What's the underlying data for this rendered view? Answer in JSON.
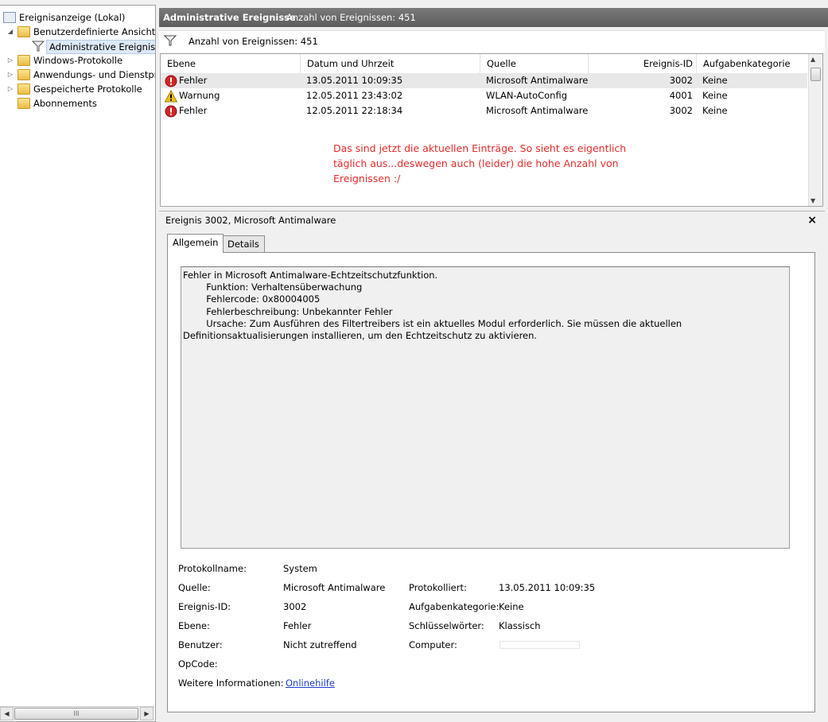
{
  "tree": {
    "items": [
      {
        "label": "Ereignisanzeige (Lokal)"
      },
      {
        "label": "Benutzerdefinierte Ansichten"
      },
      {
        "label": "Administrative Ereignisse"
      },
      {
        "label": "Windows-Protokolle"
      },
      {
        "label": "Anwendungs- und Dienstprotokolle"
      },
      {
        "label": "Gespeicherte Protokolle"
      },
      {
        "label": "Abonnements"
      }
    ],
    "scroll_glyph": "III"
  },
  "header": {
    "title": "Administrative Ereignisse",
    "count": "Anzahl von Ereignissen: 451"
  },
  "filter": {
    "text": "Anzahl von Ereignissen: 451"
  },
  "events": {
    "columns": [
      "Ebene",
      "Datum und Uhrzeit",
      "Quelle",
      "Ereignis-ID",
      "Aufgabenkategorie"
    ],
    "rows": [
      {
        "level": "Fehler",
        "icon": "error-icon",
        "datetime": "13.05.2011 10:09:35",
        "source": "Microsoft Antimalware",
        "id": "3002",
        "category": "Keine"
      },
      {
        "level": "Warnung",
        "icon": "warning-icon",
        "datetime": "12.05.2011 23:43:02",
        "source": "WLAN-AutoConfig",
        "id": "4001",
        "category": "Keine"
      },
      {
        "level": "Fehler",
        "icon": "error-icon",
        "datetime": "12.05.2011 22:18:34",
        "source": "Microsoft Antimalware",
        "id": "3002",
        "category": "Keine"
      }
    ]
  },
  "annotation": "Das sind jetzt die aktuellen Einträge. So sieht es eigentlich täglich aus...deswegen auch (leider) die hohe Anzahl von Ereignissen :/",
  "detail": {
    "title": "Ereignis 3002, Microsoft Antimalware",
    "close": "×",
    "tabs": [
      "Allgemein",
      "Details"
    ],
    "message": "Fehler in Microsoft Antimalware-Echtzeitschutzfunktion.\n \t\tFunktion: Verhaltensüberwachung\n \t\tFehlercode: 0x80004005\n \t\tFehlerbeschreibung: Unbekannter Fehler\n \t\tUrsache: Zum Ausführen des Filtertreibers ist ein aktuelles Modul erforderlich. Sie müssen die aktuellen Definitionsaktualisierungen installieren, um den Echtzeitschutz zu aktivieren.",
    "fields": {
      "protokollname_label": "Protokollname:",
      "protokollname": "System",
      "quelle_label": "Quelle:",
      "quelle": "Microsoft Antimalware",
      "protokolliert_label": "Protokolliert:",
      "protokolliert": "13.05.2011 10:09:35",
      "ereignis_id_label": "Ereignis-ID:",
      "ereignis_id": "3002",
      "aufgabenkategorie_label": "Aufgabenkategorie:",
      "aufgabenkategorie": "Keine",
      "ebene_label": "Ebene:",
      "ebene": "Fehler",
      "schluesselwoerter_label": "Schlüsselwörter:",
      "schluesselwoerter": "Klassisch",
      "benutzer_label": "Benutzer:",
      "benutzer": "Nicht zutreffend",
      "computer_label": "Computer:",
      "opcode_label": "OpCode:",
      "info_label": "Weitere Informationen:",
      "info_link": "Onlinehilfe"
    }
  },
  "colors": {
    "error": "#d32626",
    "warning": "#f2c316",
    "annotation": "#e52b2b",
    "link": "#1a3fcf"
  }
}
